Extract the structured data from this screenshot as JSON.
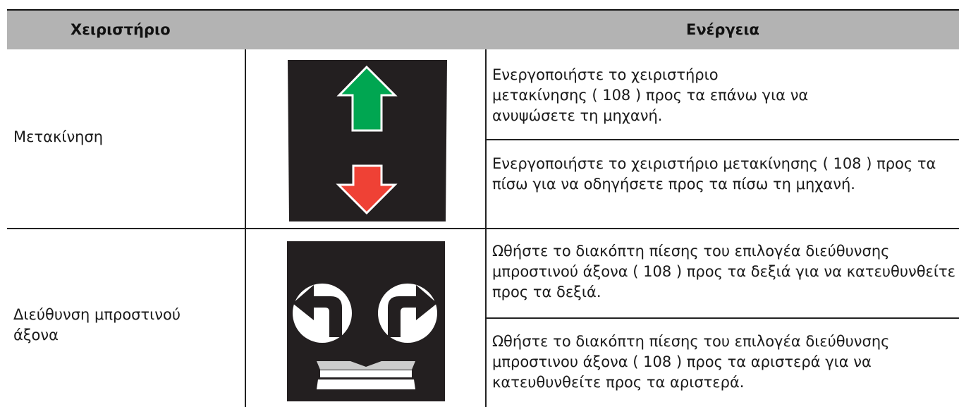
{
  "table": {
    "header": {
      "control": "Χειριστήριο",
      "action": "Ενέργεια"
    },
    "rows": [
      {
        "control": "Μετακίνηση",
        "icon": "up-down-arrows-icon",
        "actions": [
          "Ενεργοποιήστε το χειριστήριο μετακίνησης ( 108 ) προς τα επάνω για να ανυψώσετε τη μηχανή.",
          "Ενεργοποιήστε το χειριστήριο μετακίνησης ( 108 ) προς τα πίσω για να οδηγήσετε προς τα πίσω τη μηχανή."
        ]
      },
      {
        "control": "Διεύθυνση μπροστινού άξονα",
        "icon": "steer-left-right-icon",
        "actions": [
          "Ωθήστε το διακόπτη πίεσης του επιλογέα διεύθυνσης μπροστινού άξονα ( 108 ) προς τα δεξιά για να κατευθυνθείτε προς τα δεξιά.",
          "Ωθήστε το διακόπτη πίεσης του επιλογέα διεύθυνσης μπροστινου άξονα ( 108 ) προς τα αριστερά για να κατευθυνθείτε προς τα αριστερά."
        ]
      }
    ]
  },
  "colors": {
    "header_bg": "#b3b3b3",
    "icon_bg": "#231f20",
    "arrow_up": "#00a651",
    "arrow_down": "#ef4135"
  }
}
